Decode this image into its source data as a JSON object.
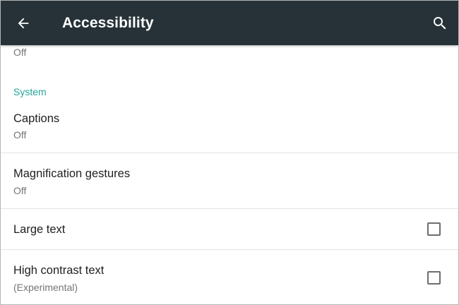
{
  "appbar": {
    "title": "Accessibility",
    "back_icon": "arrow-back-icon",
    "search_icon": "search-icon"
  },
  "colors": {
    "appbar": "#263238",
    "accent": "#26a69a"
  },
  "partial_item": {
    "summary": "Off"
  },
  "section": {
    "header": "System"
  },
  "items": [
    {
      "title": "Captions",
      "summary": "Off"
    },
    {
      "title": "Magnification gestures",
      "summary": "Off"
    },
    {
      "title": "Large text",
      "checked": false
    },
    {
      "title": "High contrast text",
      "summary": "(Experimental)",
      "checked": false
    }
  ]
}
